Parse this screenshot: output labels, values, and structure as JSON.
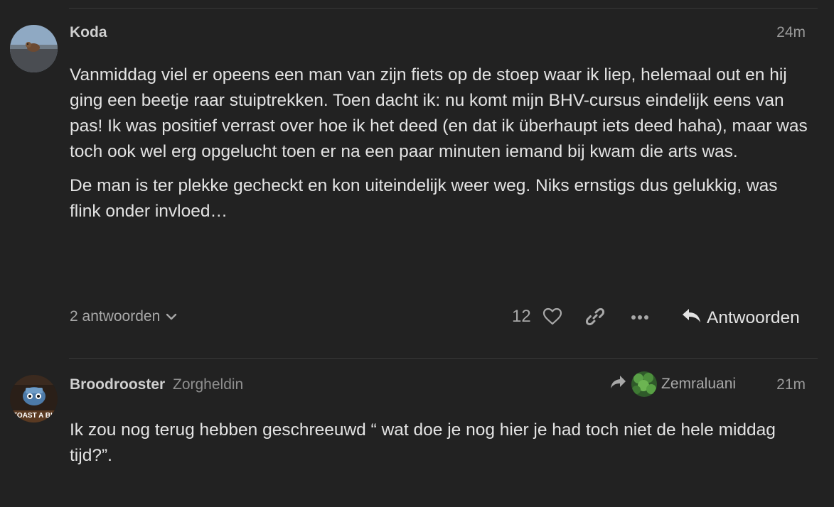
{
  "posts": [
    {
      "username": "Koda",
      "time": "24m",
      "paragraphs": [
        "Vanmiddag viel er opeens een man van zijn fiets op de stoep waar ik liep, helemaal out en hij ging een beetje raar stuiptrekken. Toen dacht ik: nu komt mijn BHV-cursus eindelijk eens van pas! Ik was positief verrast over hoe ik het deed (en dat ik überhaupt iets deed haha), maar was toch ook wel erg opgelucht toen er na een paar minuten iemand bij kwam die arts was.",
        "De man is ter plekke gecheckt en kon uiteindelijk weer weg. Niks ernstigs dus gelukkig, was flink onder invloed…"
      ],
      "replies_label": "2 antwoorden",
      "like_count": "12",
      "reply_label": "Antwoorden",
      "icons": {
        "like": "heart-icon",
        "link": "link-icon",
        "more": "more-icon",
        "reply": "reply-icon",
        "expand": "chevron-down-icon"
      }
    },
    {
      "username": "Broodrooster",
      "user_title": "Zorgheldin",
      "reply_to": "Zemraluani",
      "time": "21m",
      "avatar_text": "TOAST A BI",
      "paragraphs": [
        "Ik zou nog terug hebben geschreeuwd “ wat doe je nog hier je had toch niet de hele middag tijd?”."
      ]
    }
  ],
  "colors": {
    "background": "#222222",
    "text": "#e3e3e3",
    "muted": "#9a9a9a",
    "divider": "#393939"
  }
}
